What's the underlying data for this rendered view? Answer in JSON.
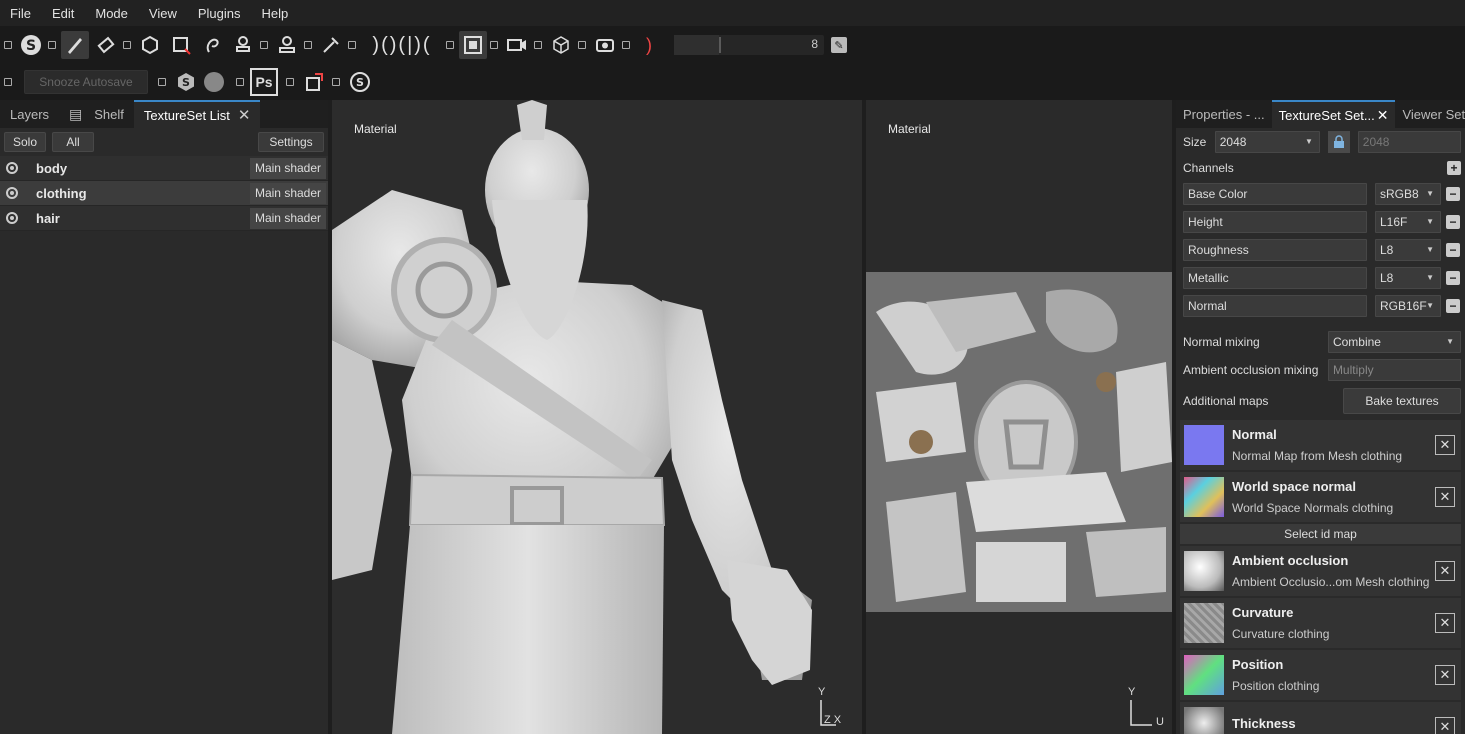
{
  "menu": [
    "File",
    "Edit",
    "Mode",
    "View",
    "Plugins",
    "Help"
  ],
  "toolbar": {
    "brush_size_value": "8",
    "snooze_label": "Snooze Autosave",
    "photoshop_label": "Ps"
  },
  "left_panel": {
    "tabs": [
      {
        "label": "Layers"
      },
      {
        "label": "Shelf"
      },
      {
        "label": "TextureSet List"
      }
    ],
    "solo_label": "Solo",
    "all_label": "All",
    "settings_label": "Settings",
    "texture_sets": [
      {
        "name": "body",
        "shader": "Main shader"
      },
      {
        "name": "clothing",
        "shader": "Main shader"
      },
      {
        "name": "hair",
        "shader": "Main shader"
      }
    ]
  },
  "viewport3d": {
    "label": "Material",
    "axis_y": "Y",
    "axis_x": "Z X"
  },
  "viewport2d": {
    "label": "Material",
    "axis_y": "Y",
    "axis_x": "U"
  },
  "right_panel": {
    "tabs": [
      {
        "label": "Properties - ..."
      },
      {
        "label": "TextureSet Set..."
      },
      {
        "label": "Viewer Set..."
      }
    ],
    "size_label": "Size",
    "size_value": "2048",
    "size_value_locked": "2048",
    "channels_label": "Channels",
    "channels": [
      {
        "name": "Base Color",
        "format": "sRGB8"
      },
      {
        "name": "Height",
        "format": "L16F"
      },
      {
        "name": "Roughness",
        "format": "L8"
      },
      {
        "name": "Metallic",
        "format": "L8"
      },
      {
        "name": "Normal",
        "format": "RGB16F"
      }
    ],
    "normal_mixing_label": "Normal mixing",
    "normal_mixing_value": "Combine",
    "ao_mixing_label": "Ambient occlusion mixing",
    "ao_mixing_value": "Multiply",
    "additional_maps_label": "Additional maps",
    "bake_label": "Bake textures",
    "select_id_label": "Select id map",
    "maps": [
      {
        "title": "Normal",
        "sub": "Normal Map from Mesh clothing",
        "color": "#7a78f0"
      },
      {
        "title": "World space normal",
        "sub": "World Space Normals clothing",
        "color": "#c06bb8"
      },
      {
        "title": "Ambient occlusion",
        "sub": "Ambient Occlusio...om Mesh clothing",
        "color": "#e8e8e8"
      },
      {
        "title": "Curvature",
        "sub": "Curvature clothing",
        "color": "#9a9a9a"
      },
      {
        "title": "Position",
        "sub": "Position clothing",
        "color": "#6fd18a"
      },
      {
        "title": "Thickness",
        "sub": "",
        "color": "#cfcfcf"
      }
    ]
  }
}
